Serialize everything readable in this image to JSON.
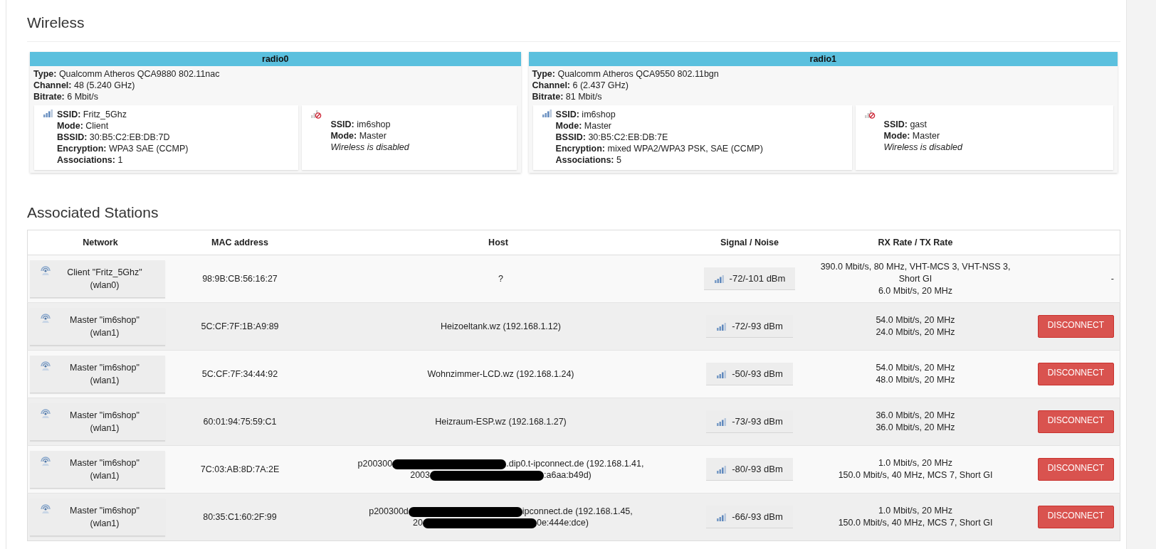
{
  "wireless": {
    "title": "Wireless",
    "radios": [
      {
        "name": "radio0",
        "info": [
          {
            "label": "Type:",
            "value": "Qualcomm Atheros QCA9880 802.11nac"
          },
          {
            "label": "Channel:",
            "value": "48 (5.240 GHz)"
          },
          {
            "label": "Bitrate:",
            "value": "6 Mbit/s"
          }
        ],
        "networks": [
          {
            "enabled": true,
            "fields": [
              {
                "label": "SSID:",
                "value": "Fritz_5Ghz"
              },
              {
                "label": "Mode:",
                "value": "Client"
              },
              {
                "label": "BSSID:",
                "value": "30:B5:C2:EB:DB:7D"
              },
              {
                "label": "Encryption:",
                "value": "WPA3 SAE (CCMP)"
              },
              {
                "label": "Associations:",
                "value": "1"
              }
            ]
          },
          {
            "enabled": false,
            "fields": [
              {
                "label": "SSID:",
                "value": "im6shop"
              },
              {
                "label": "Mode:",
                "value": "Master"
              }
            ],
            "note": "Wireless is disabled"
          }
        ]
      },
      {
        "name": "radio1",
        "info": [
          {
            "label": "Type:",
            "value": "Qualcomm Atheros QCA9550 802.11bgn"
          },
          {
            "label": "Channel:",
            "value": "6 (2.437 GHz)"
          },
          {
            "label": "Bitrate:",
            "value": "81 Mbit/s"
          }
        ],
        "networks": [
          {
            "enabled": true,
            "fields": [
              {
                "label": "SSID:",
                "value": "im6shop"
              },
              {
                "label": "Mode:",
                "value": "Master"
              },
              {
                "label": "BSSID:",
                "value": "30:B5:C2:EB:DB:7E"
              },
              {
                "label": "Encryption:",
                "value": "mixed WPA2/WPA3 PSK, SAE (CCMP)"
              },
              {
                "label": "Associations:",
                "value": "5"
              }
            ]
          },
          {
            "enabled": false,
            "fields": [
              {
                "label": "SSID:",
                "value": "gast"
              },
              {
                "label": "Mode:",
                "value": "Master"
              }
            ],
            "note": "Wireless is disabled"
          }
        ]
      }
    ]
  },
  "stations": {
    "title": "Associated Stations",
    "columns": [
      "Network",
      "MAC address",
      "Host",
      "Signal / Noise",
      "RX Rate / TX Rate"
    ],
    "rows": [
      {
        "network": "Client \"Fritz_5Ghz\"",
        "iface": "(wlan0)",
        "mac": "98:9B:CB:56:16:27",
        "host": [
          {
            "before": "?"
          }
        ],
        "signal": "-72/-101 dBm",
        "rates": [
          "390.0 Mbit/s, 80 MHz, VHT-MCS 3, VHT-NSS 3, Short GI",
          "6.0 Mbit/s, 20 MHz"
        ],
        "action": {
          "kind": "text",
          "text": "-"
        }
      },
      {
        "network": "Master \"im6shop\"",
        "iface": "(wlan1)",
        "mac": "5C:CF:7F:1B:A9:89",
        "host": [
          {
            "before": "Heizoeltank.wz (192.168.1.12)"
          }
        ],
        "signal": "-72/-93 dBm",
        "rates": [
          "54.0 Mbit/s, 20 MHz",
          "24.0 Mbit/s, 20 MHz"
        ],
        "action": {
          "kind": "button",
          "text": "DISCONNECT"
        }
      },
      {
        "network": "Master \"im6shop\"",
        "iface": "(wlan1)",
        "mac": "5C:CF:7F:34:44:92",
        "host": [
          {
            "before": "Wohnzimmer-LCD.wz (192.168.1.24)"
          }
        ],
        "signal": "-50/-93 dBm",
        "rates": [
          "54.0 Mbit/s, 20 MHz",
          "48.0 Mbit/s, 20 MHz"
        ],
        "action": {
          "kind": "button",
          "text": "DISCONNECT"
        }
      },
      {
        "network": "Master \"im6shop\"",
        "iface": "(wlan1)",
        "mac": "60:01:94:75:59:C1",
        "host": [
          {
            "before": "Heizraum-ESP.wz (192.168.1.27)"
          }
        ],
        "signal": "-73/-93 dBm",
        "rates": [
          "36.0 Mbit/s, 20 MHz",
          "36.0 Mbit/s, 20 MHz"
        ],
        "action": {
          "kind": "button",
          "text": "DISCONNECT"
        }
      },
      {
        "network": "Master \"im6shop\"",
        "iface": "(wlan1)",
        "mac": "7C:03:AB:8D:7A:2E",
        "host": [
          {
            "before": "p200300",
            "after": ".dip0.t-ipconnect.de (192.168.1.41,"
          },
          {
            "before": "2003",
            "after": ":a6aa:b49d)"
          }
        ],
        "signal": "-80/-93 dBm",
        "rates": [
          "1.0 Mbit/s, 20 MHz",
          "150.0 Mbit/s, 40 MHz, MCS 7, Short GI"
        ],
        "action": {
          "kind": "button",
          "text": "DISCONNECT"
        }
      },
      {
        "network": "Master \"im6shop\"",
        "iface": "(wlan1)",
        "mac": "80:35:C1:60:2F:99",
        "host": [
          {
            "before": "p200300d",
            "after": "ipconnect.de (192.168.1.45,"
          },
          {
            "before": "20",
            "after": "0e:444e:dce)"
          }
        ],
        "signal": "-66/-93 dBm",
        "rates": [
          "1.0 Mbit/s, 20 MHz",
          "150.0 Mbit/s, 40 MHz, MCS 7, Short GI"
        ],
        "action": {
          "kind": "button",
          "text": "DISCONNECT"
        }
      }
    ]
  }
}
